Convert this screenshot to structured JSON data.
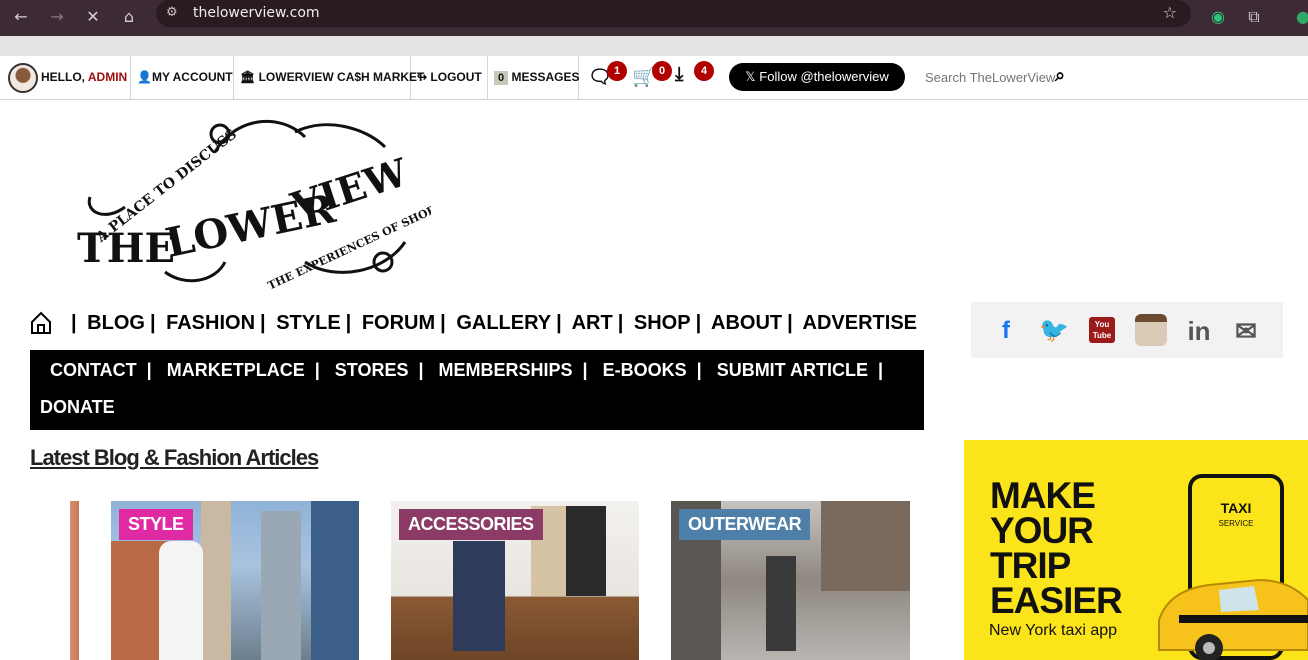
{
  "browser": {
    "url": "thelowerview.com"
  },
  "topbar": {
    "greeting": "HELLO,",
    "username": "ADMIN",
    "my_account": "MY ACCOUNT",
    "cash_market": "LOWERVIEW CA$H MARKET",
    "logout": "LOGOUT",
    "messages_count": "0",
    "messages": "MESSAGES",
    "comments_badge": "1",
    "cart_badge": "0",
    "downloads_badge": "4",
    "follow": "Follow @thelowerview",
    "search_placeholder": "Search TheLowerView"
  },
  "logo": {
    "top": "A PLACE TO DISCUSS",
    "the": "THE",
    "lower": "LOWER",
    "view": "VIEW",
    "bottom": "THE EXPERIENCES OF SHORTER MEN"
  },
  "nav_primary": [
    "BLOG",
    "FASHION",
    "STYLE",
    "FORUM",
    "GALLERY",
    "ART",
    "SHOP",
    "ABOUT",
    "ADVERTISE"
  ],
  "nav_secondary": [
    "CONTACT",
    "MARKETPLACE",
    "STORES",
    "MEMBERSHIPS",
    "E-BOOKS",
    "SUBMIT ARTICLE"
  ],
  "nav_secondary_row2": "DONATE",
  "social": [
    "facebook",
    "twitter",
    "youtube",
    "instagram",
    "linkedin",
    "email"
  ],
  "social_labels": {
    "linkedin": "in",
    "youtube": "You Tube"
  },
  "section_title": "Latest Blog & Fashion Articles",
  "articles": [
    {
      "tag": "STYLE",
      "tag_color": "#e02aa4"
    },
    {
      "tag": "ACCESSORIES",
      "tag_color": "#8c3a66"
    },
    {
      "tag": "OUTERWEAR",
      "tag_color": "#4e7fa8"
    }
  ],
  "ad": {
    "line1": "MAKE",
    "line2": "YOUR",
    "line3": "TRIP",
    "line4": "EASIER",
    "subtitle": "New York taxi app",
    "phone_title": "TAXI",
    "phone_sub": "SERVICE"
  }
}
